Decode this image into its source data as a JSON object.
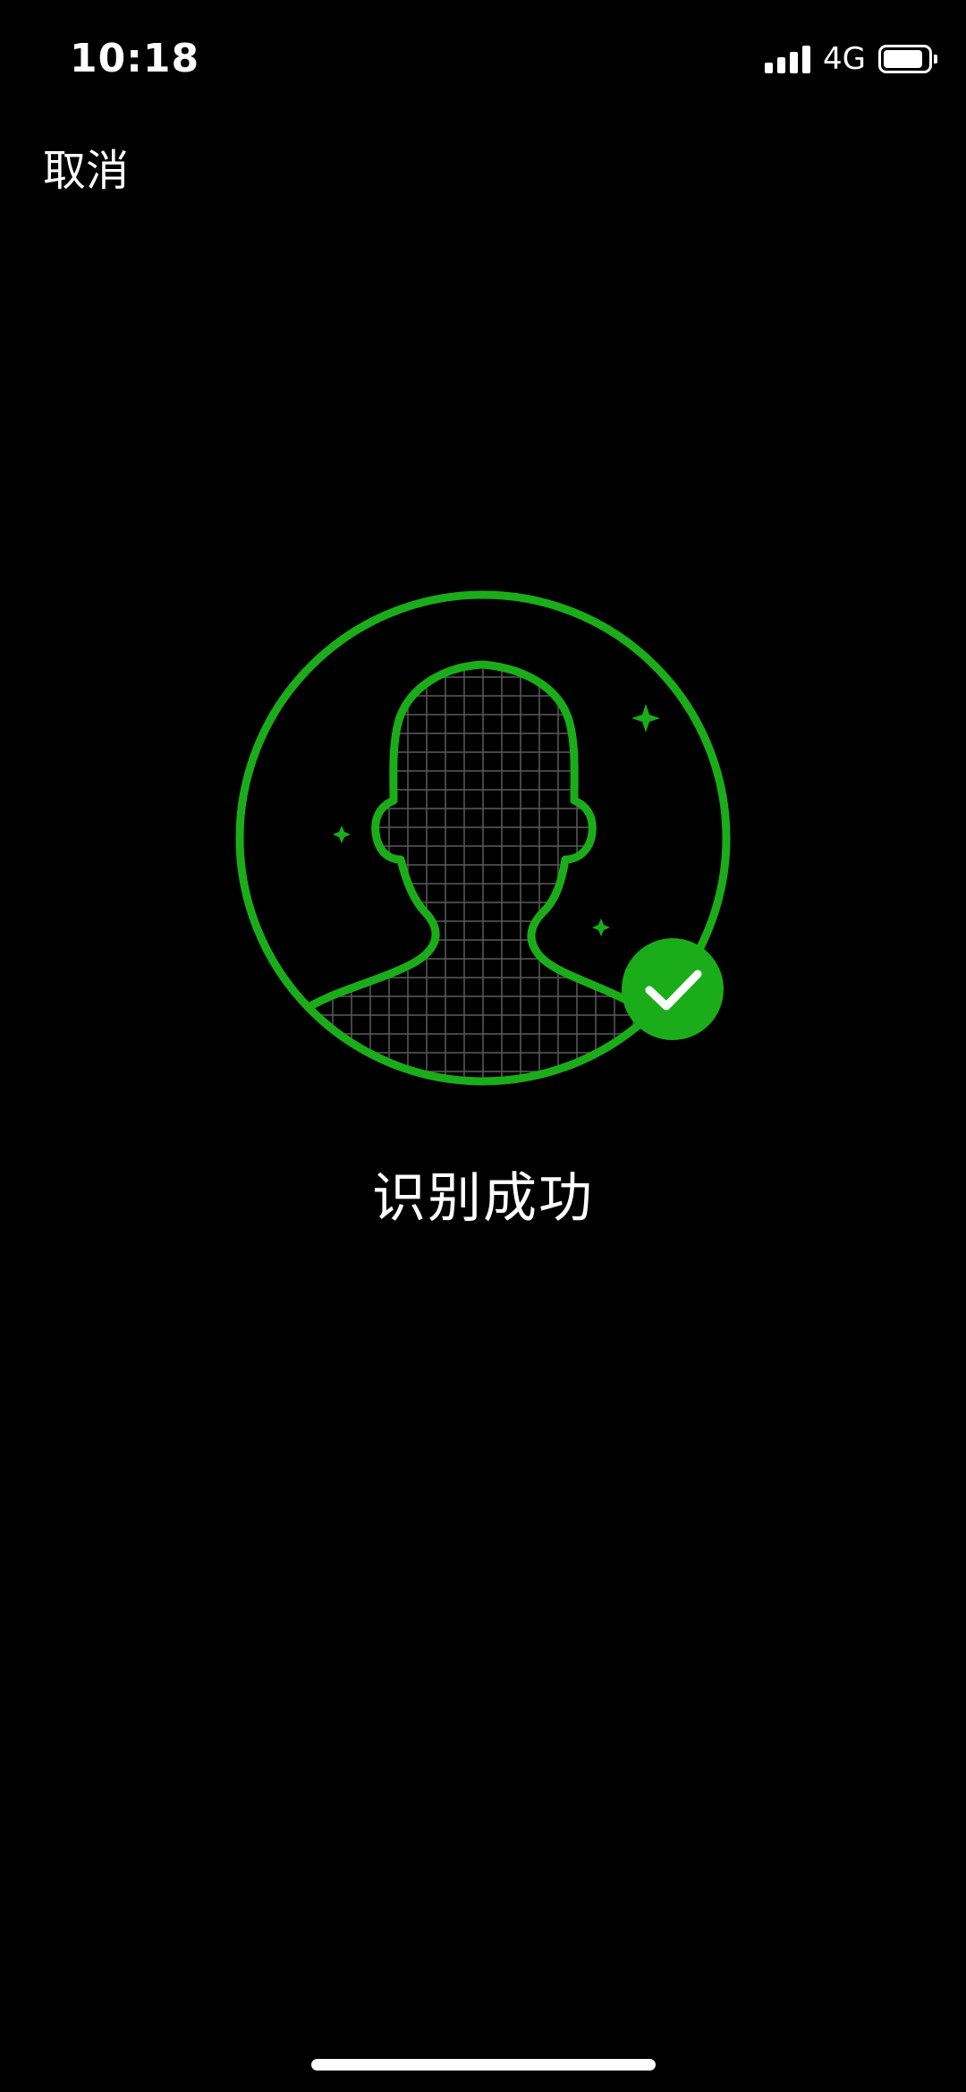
{
  "status_bar": {
    "time": "10:18",
    "network": "4G",
    "signal_bars": 4,
    "battery_level": 0.9,
    "icons": [
      "signal-icon",
      "battery-icon"
    ]
  },
  "nav": {
    "cancel_label": "取消"
  },
  "illustration": {
    "icon": "face-grid-icon",
    "status_icon": "check-circle-icon",
    "accent_color": "#1aad19"
  },
  "result": {
    "title": "识别成功"
  },
  "colors": {
    "background": "#000000",
    "text": "#ffffff",
    "accent": "#1aad19"
  }
}
